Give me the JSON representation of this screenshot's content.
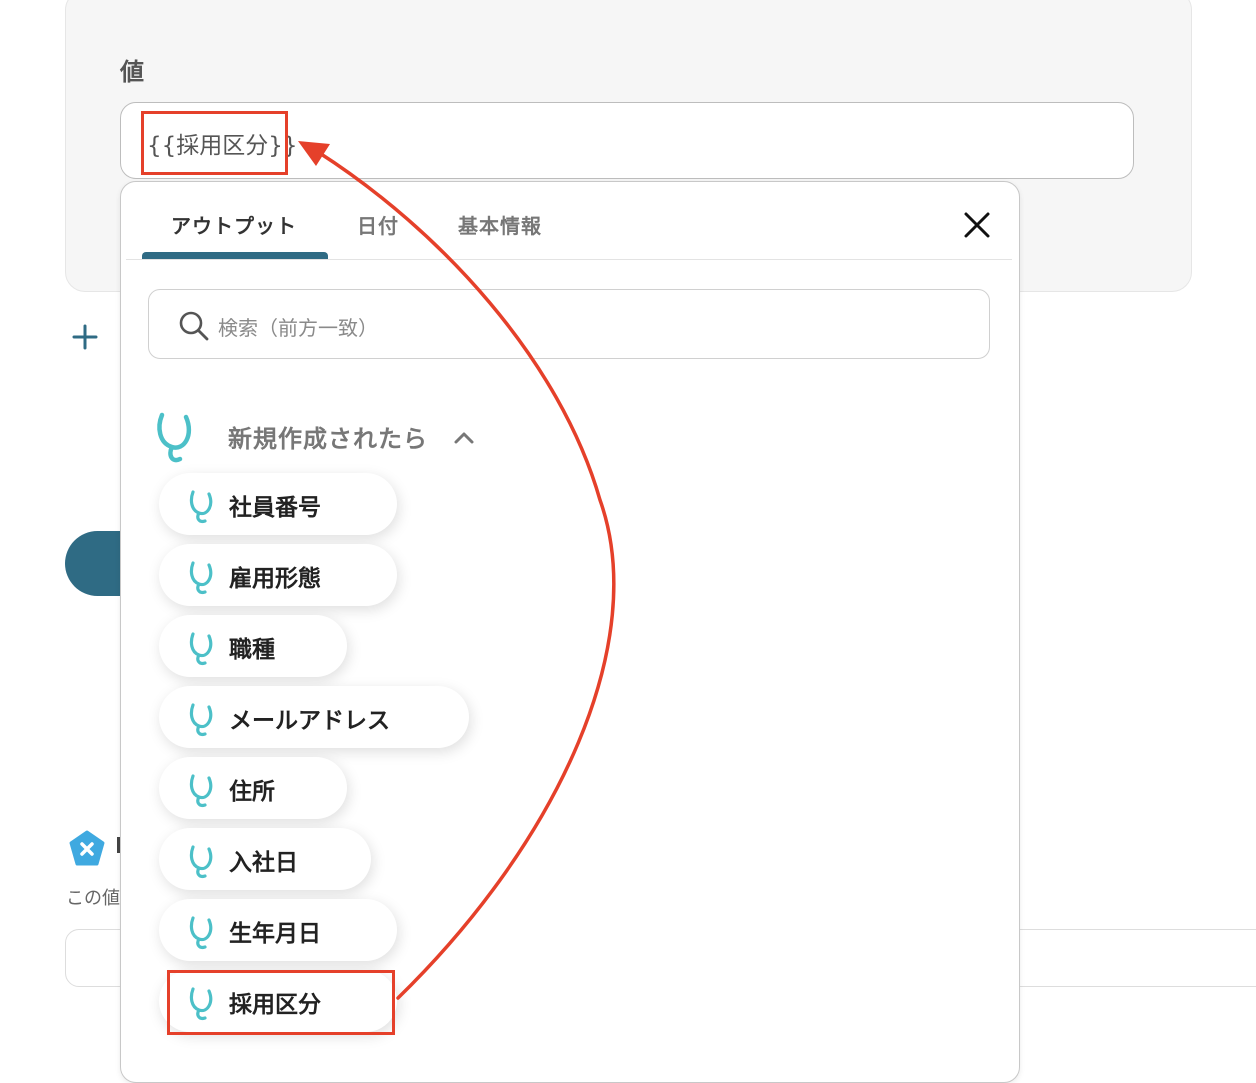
{
  "field": {
    "label": "値",
    "value": "{{採用区分}}"
  },
  "background": {
    "partial_text": "この値"
  },
  "picker": {
    "tabs": [
      {
        "label": "アウトプット",
        "active": true
      },
      {
        "label": "日付",
        "active": false
      },
      {
        "label": "基本情報",
        "active": false
      }
    ],
    "search": {
      "placeholder": "検索（前方一致）"
    },
    "group": {
      "title": "新規作成されたら",
      "expanded": true,
      "items": [
        {
          "label": "社員番号"
        },
        {
          "label": "雇用形態"
        },
        {
          "label": "職種"
        },
        {
          "label": "メールアドレス"
        },
        {
          "label": "住所"
        },
        {
          "label": "入社日"
        },
        {
          "label": "生年月日"
        },
        {
          "label": "採用区分",
          "highlighted": true
        }
      ]
    }
  },
  "colors": {
    "accent": "#2f6b84",
    "annotation": "#e5402a",
    "icon_teal": "#4cc0c8"
  },
  "icons": [
    "plus-icon",
    "close-icon",
    "search-icon",
    "chevron-up-icon",
    "app-logo-icon",
    "x-badge-icon"
  ]
}
